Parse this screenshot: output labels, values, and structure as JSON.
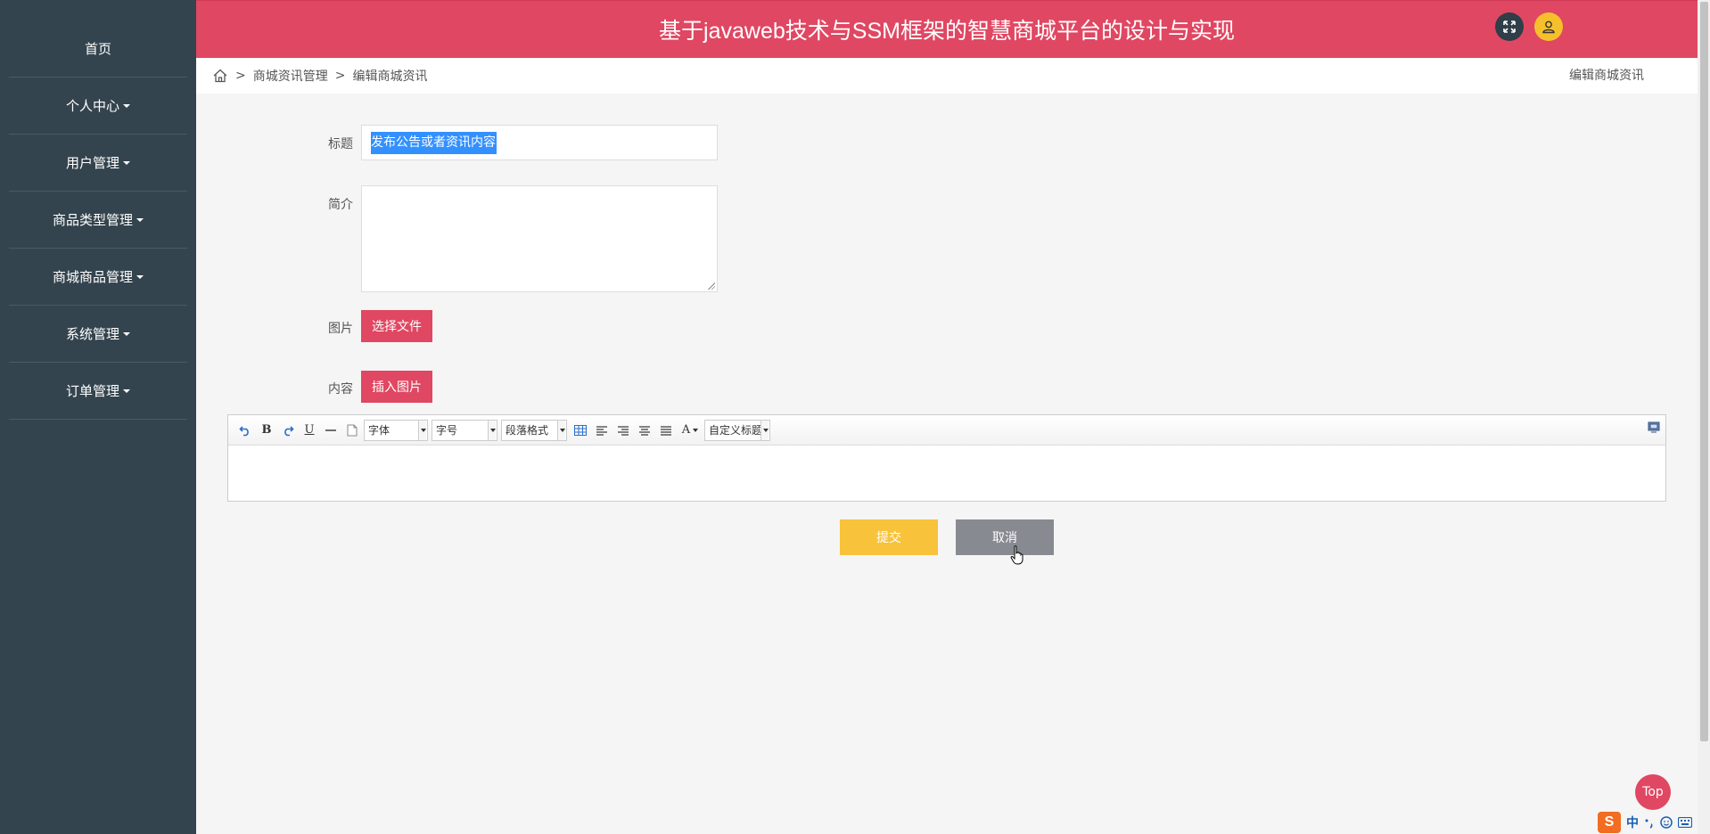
{
  "header": {
    "title": "基于javaweb技术与SSM框架的智慧商城平台的设计与实现"
  },
  "sidebar": {
    "items": [
      {
        "label": "首页",
        "dropdown": false
      },
      {
        "label": "个人中心",
        "dropdown": true
      },
      {
        "label": "用户管理",
        "dropdown": true
      },
      {
        "label": "商品类型管理",
        "dropdown": true
      },
      {
        "label": "商城商品管理",
        "dropdown": true
      },
      {
        "label": "系统管理",
        "dropdown": true
      },
      {
        "label": "订单管理",
        "dropdown": true
      }
    ]
  },
  "breadcrumb": {
    "sep": ">",
    "level1": "商城资讯管理",
    "level2": "编辑商城资讯",
    "right": "编辑商城资讯"
  },
  "form": {
    "title_label": "标题",
    "title_value": "发布公告或者资讯内容",
    "intro_label": "简介",
    "intro_value": "",
    "image_label": "图片",
    "choose_file": "选择文件",
    "content_label": "内容",
    "insert_image": "插入图片"
  },
  "editor": {
    "font_family": "字体",
    "font_size": "字号",
    "paragraph": "段落格式",
    "custom_title": "自定义标题"
  },
  "actions": {
    "submit": "提交",
    "cancel": "取消"
  },
  "top_button": "Top",
  "ime": {
    "lang": "中",
    "logo": "S"
  },
  "colors": {
    "header": "#e04762",
    "sidebar": "#34444e",
    "submit": "#f8c33a",
    "cancel": "#888a92",
    "selection": "#3390ff"
  }
}
